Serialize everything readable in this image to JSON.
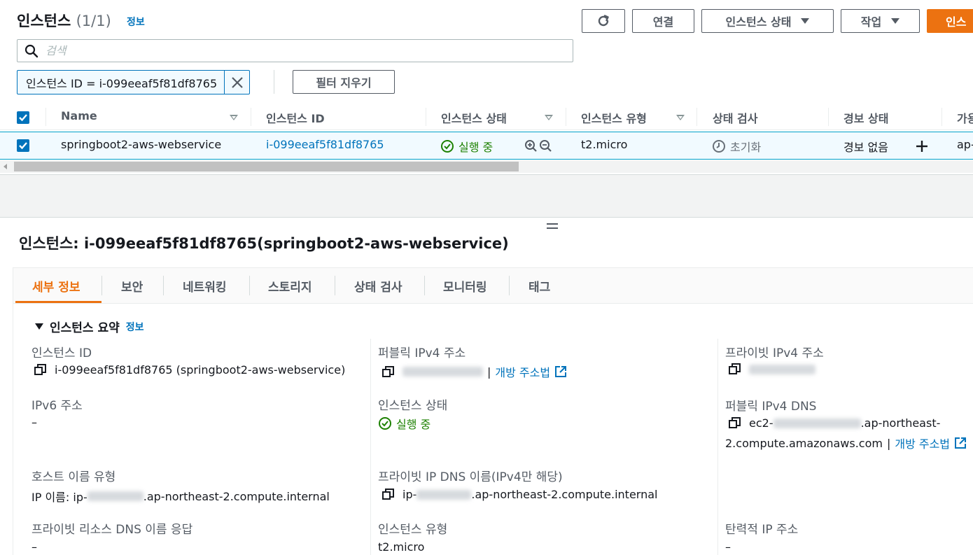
{
  "header": {
    "title": "인스턴스",
    "count": "(1/1)",
    "info_link": "정보",
    "buttons": {
      "connect": "연결",
      "instance_state": "인스턴스 상태",
      "actions": "작업",
      "launch": "인스"
    }
  },
  "search": {
    "placeholder": "검색"
  },
  "filter": {
    "token": "인스턴스 ID = i-099eeaf5f81df8765",
    "clear_label": "필터 지우기"
  },
  "table": {
    "columns": [
      "Name",
      "인스턴스 ID",
      "인스턴스 상태",
      "인스턴스 유형",
      "상태 검사",
      "경보 상태",
      "가용"
    ],
    "row": {
      "name": "springboot2-aws-webservice",
      "instance_id": "i-099eeaf5f81df8765",
      "state": "실행 중",
      "type": "t2.micro",
      "status_check": "초기화",
      "alarm": "경보 없음",
      "az": "ap-"
    }
  },
  "detail": {
    "title": "인스턴스: i-099eeaf5f81df8765(springboot2-aws-webservice)",
    "tabs": [
      "세부 정보",
      "보안",
      "네트워킹",
      "스토리지",
      "상태 검사",
      "모니터링",
      "태그"
    ],
    "active_tab": "세부 정보",
    "section_title": "인스턴스 요약",
    "section_info": "정보",
    "fields": {
      "instance_id_label": "인스턴스 ID",
      "instance_id_value": "i-099eeaf5f81df8765 (springboot2-aws-webservice)",
      "public_ipv4_label": "퍼블릭 IPv4 주소",
      "open_address": "개방 주소법",
      "private_ipv4_label": "프라이빗 IPv4 주소",
      "ipv6_label": "IPv6 주소",
      "ipv6_value": "–",
      "state_label": "인스턴스 상태",
      "state_value": "실행 중",
      "public_dns_label": "퍼블릭 IPv4 DNS",
      "public_dns_prefix": "ec2-",
      "public_dns_suffix": ".ap-northeast-",
      "public_dns_line2": "2.compute.amazonaws.com",
      "hostname_type_label": "호스트 이름 유형",
      "hostname_prefix": "IP 이름: ip-",
      "hostname_suffix": ".ap-northeast-2.compute.internal",
      "private_dns_label": "프라이빗 IP DNS 이름(IPv4만 해당)",
      "private_dns_prefix": "ip-",
      "private_dns_suffix": ".ap-northeast-2.compute.internal",
      "resource_dns_label": "프라이빗 리소스 DNS 이름 응답",
      "resource_dns_value": "–",
      "instance_type_label": "인스턴스 유형",
      "instance_type_value": "t2.micro",
      "elastic_ip_label": "탄력적 IP 주소",
      "elastic_ip_value": "–"
    }
  },
  "colors": {
    "accent_orange": "#ec7211",
    "link_blue": "#0073bb",
    "success_green": "#1d8102"
  }
}
